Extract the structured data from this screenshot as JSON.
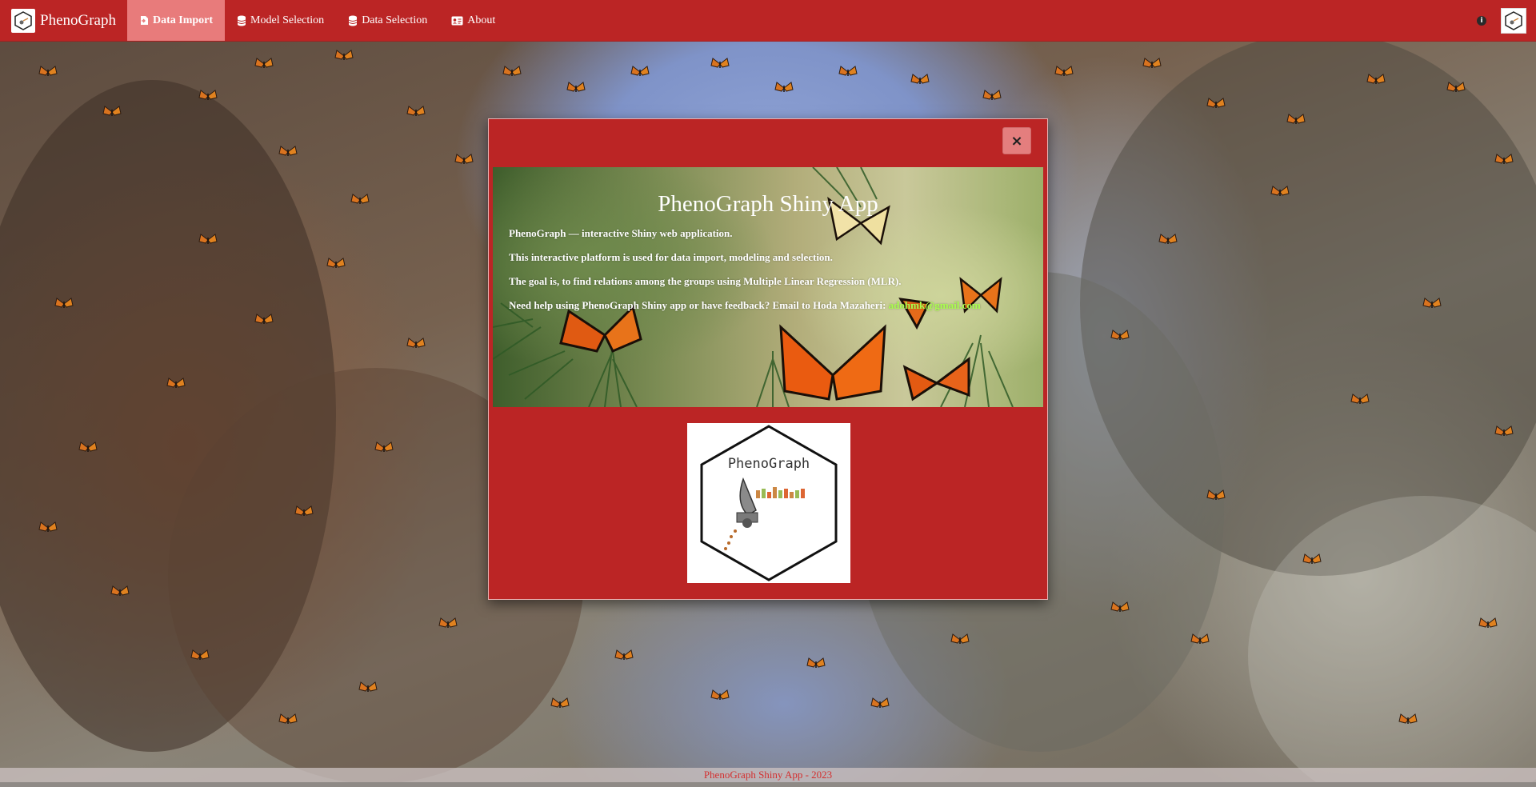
{
  "navbar": {
    "brand": "PhenoGraph",
    "items": [
      {
        "label": "Data Import",
        "icon": "file-import-icon",
        "active": true
      },
      {
        "label": "Model Selection",
        "icon": "database-icon",
        "active": false
      },
      {
        "label": "Data Selection",
        "icon": "database-icon",
        "active": false
      },
      {
        "label": "About",
        "icon": "id-card-icon",
        "active": false
      }
    ]
  },
  "modal": {
    "close_label": "×",
    "title": "PhenoGraph Shiny App",
    "line1": "PhenoGraph — interactive Shiny web application.",
    "line2": "This interactive platform is used for data import, modeling and selection.",
    "line3": "The goal is, to find relations among the groups using Multiple Linear Regression (MLR).",
    "line4_prefix": "Need help using PhenoGraph Shiny app or have feedback? Email to Hoda Mazaheri:",
    "email": "adohmk@gmail.com",
    "logo_text": "PhenoGraph"
  },
  "footer": {
    "text": "PhenoGraph Shiny App - 2023"
  },
  "colors": {
    "navbar": "#bb2525",
    "active_tab": "#e87b7b",
    "email": "#a9ff4d",
    "footer_text": "#d32f2f"
  }
}
